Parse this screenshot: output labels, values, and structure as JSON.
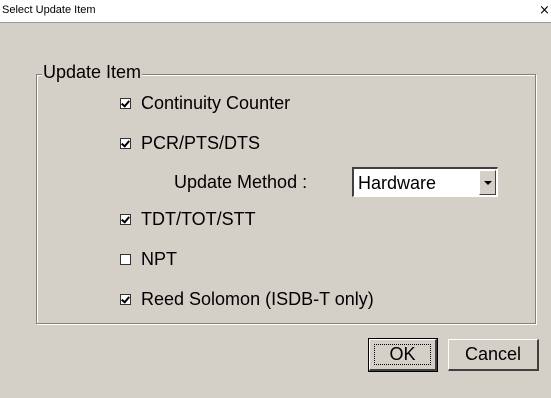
{
  "window": {
    "title": "Select Update Item",
    "close_glyph": "×"
  },
  "group": {
    "legend": "Update Item"
  },
  "options": [
    {
      "label": "Continuity Counter",
      "checked": true
    },
    {
      "label": "PCR/PTS/DTS",
      "checked": true
    },
    {
      "label": "TDT/TOT/STT",
      "checked": true
    },
    {
      "label": "NPT",
      "checked": false
    },
    {
      "label": "Reed Solomon (ISDB-T only)",
      "checked": true
    }
  ],
  "update_method": {
    "label": "Update Method :",
    "selected": "Hardware"
  },
  "buttons": {
    "ok": "OK",
    "cancel": "Cancel"
  },
  "colors": {
    "dialog_bg": "#d4d0c8",
    "titlebar_bg": "#ffffff"
  },
  "icons": {
    "close": "close-icon",
    "check": "check-icon",
    "dropdown": "chevron-down-icon"
  }
}
